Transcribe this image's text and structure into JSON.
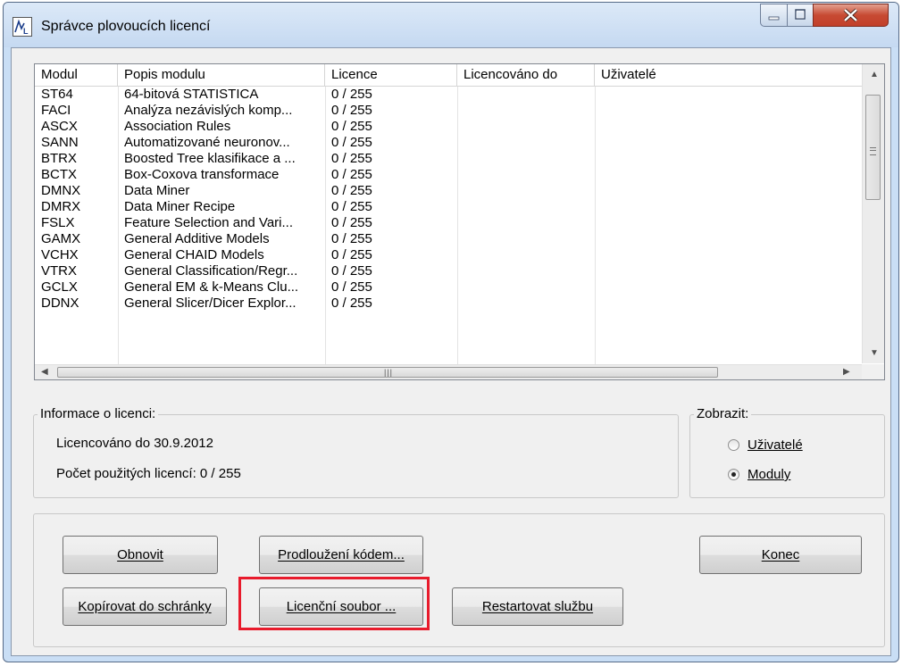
{
  "window": {
    "title": "Správce plovoucích licencí",
    "icon": "statistica-license-icon",
    "controls": [
      "minimize-icon",
      "maximize-icon",
      "close-icon"
    ],
    "accent": "#e81b2c"
  },
  "list": {
    "columns": [
      "Modul",
      "Popis modulu",
      "Licence",
      "Licencováno do",
      "Uživatelé"
    ],
    "rows": [
      [
        "ST64",
        "64-bitová STATISTICA",
        "0 / 255"
      ],
      [
        "FACI",
        "Analýza nezávislých komp...",
        "0 / 255"
      ],
      [
        "ASCX",
        "Association Rules",
        "0 / 255"
      ],
      [
        "SANN",
        "Automatizované neuronov...",
        "0 / 255"
      ],
      [
        "BTRX",
        "Boosted Tree klasifikace a ...",
        "0 / 255"
      ],
      [
        "BCTX",
        "Box-Coxova transformace",
        "0 / 255"
      ],
      [
        "DMNX",
        "Data Miner",
        "0 / 255"
      ],
      [
        "DMRX",
        "Data Miner Recipe",
        "0 / 255"
      ],
      [
        "FSLX",
        "Feature Selection and Vari...",
        "0 / 255"
      ],
      [
        "GAMX",
        "General Additive Models",
        "0 / 255"
      ],
      [
        "VCHX",
        "General CHAID Models",
        "0 / 255"
      ],
      [
        "VTRX",
        "General Classification/Regr...",
        "0 / 255"
      ],
      [
        "GCLX",
        "General EM & k-Means Clu...",
        "0 / 255"
      ],
      [
        "DDNX",
        "General Slicer/Dicer Explor...",
        "0 / 255"
      ]
    ]
  },
  "info": {
    "legend": "Informace o licenci:",
    "licensed_until": "Licencováno do 30.9.2012",
    "used": "Počet použitých licencí:  0 / 255"
  },
  "view": {
    "legend": "Zobrazit:",
    "options": [
      {
        "label": "Uživatelé",
        "checked": false
      },
      {
        "label": "Moduly",
        "checked": true
      }
    ]
  },
  "buttons": {
    "refresh": "Obnovit",
    "extend": "Prodloužení kódem...",
    "close": "Konec",
    "copy": "Kopírovat do schránky",
    "license_file": "Licenční soubor ...",
    "restart": "Restartovat službu"
  }
}
